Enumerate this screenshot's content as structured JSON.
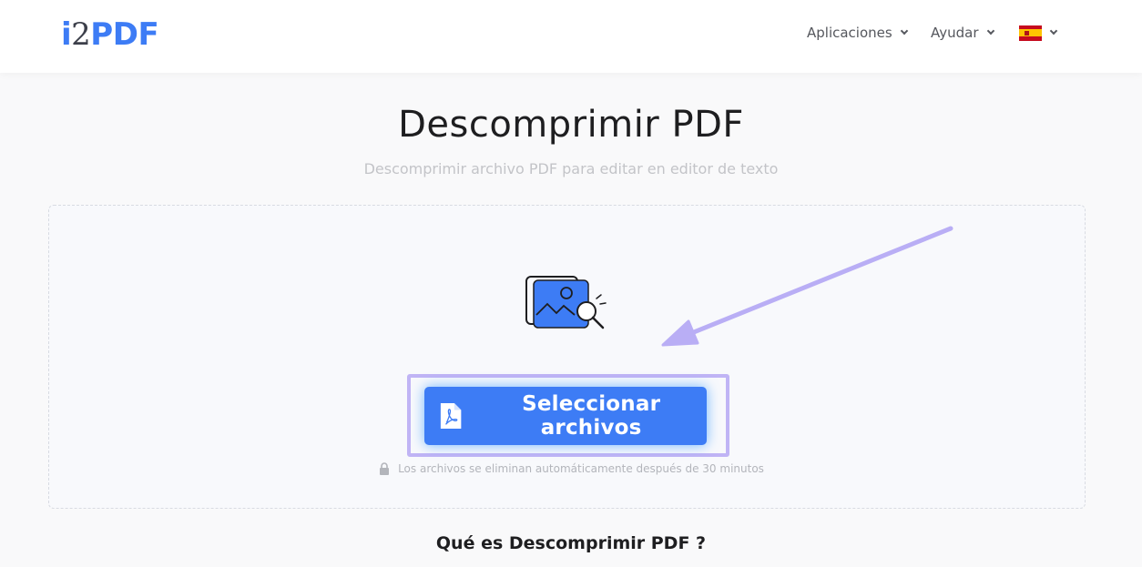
{
  "header": {
    "logo": {
      "part1": "i",
      "part2": "2",
      "part3": "PDF"
    },
    "nav": {
      "apps_label": "Aplicaciones",
      "help_label": "Ayudar",
      "language_flag": "spain-flag-icon"
    }
  },
  "main": {
    "title": "Descomprimir PDF",
    "subtitle": "Descomprimir archivo PDF para editar en editor de texto",
    "upload": {
      "illustration_icon": "image-search-icon",
      "button_label": "Seleccionar archivos",
      "button_icon": "pdf-file-icon",
      "notice": "Los archivos se eliminan automáticamente después de 30 minutos",
      "notice_icon": "lock-icon"
    },
    "section_title": "Qué es Descomprimir PDF ?"
  },
  "colors": {
    "brand_blue": "#3d7cf5",
    "highlight_purple": "#c0b4f5",
    "arrow_purple": "#b9aef5"
  }
}
